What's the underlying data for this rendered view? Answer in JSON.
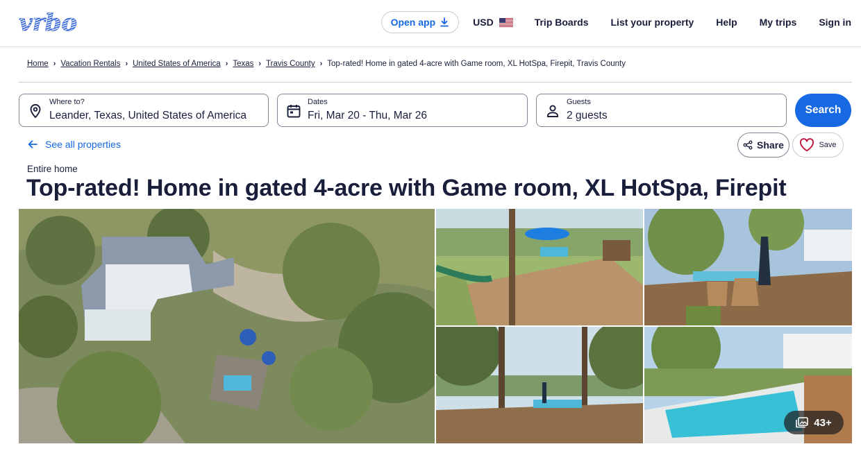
{
  "header": {
    "logo_text": "Vrbo",
    "open_app": "Open app",
    "currency": "USD",
    "nav": [
      "Trip Boards",
      "List your property",
      "Help",
      "My trips",
      "Sign in"
    ]
  },
  "breadcrumb": [
    "Home",
    "Vacation Rentals",
    "United States of America",
    "Texas",
    "Travis County",
    "Top-rated! Home in gated 4-acre with Game room, XL HotSpa, Firepit, Travis County"
  ],
  "search": {
    "where_label": "Where to?",
    "where_value": "Leander, Texas, United States of America",
    "dates_label": "Dates",
    "dates_value": "Fri, Mar 20 - Thu, Mar 26",
    "guests_label": "Guests",
    "guests_value": "2 guests",
    "button": "Search"
  },
  "back_link": "See all properties",
  "actions": {
    "share": "Share",
    "save": "Save"
  },
  "listing": {
    "type": "Entire home",
    "title": "Top-rated! Home in gated 4-acre with Game room, XL HotSpa, Firepit"
  },
  "gallery": {
    "photo_count": "43+"
  },
  "colors": {
    "brand_blue": "#1668e3",
    "text": "#191e3b",
    "border": "#818494"
  },
  "icons": [
    "download-icon",
    "us-flag-icon",
    "chevron-right-icon",
    "location-pin-icon",
    "calendar-icon",
    "person-icon",
    "arrow-left-icon",
    "share-icon",
    "heart-icon",
    "gallery-icon"
  ]
}
